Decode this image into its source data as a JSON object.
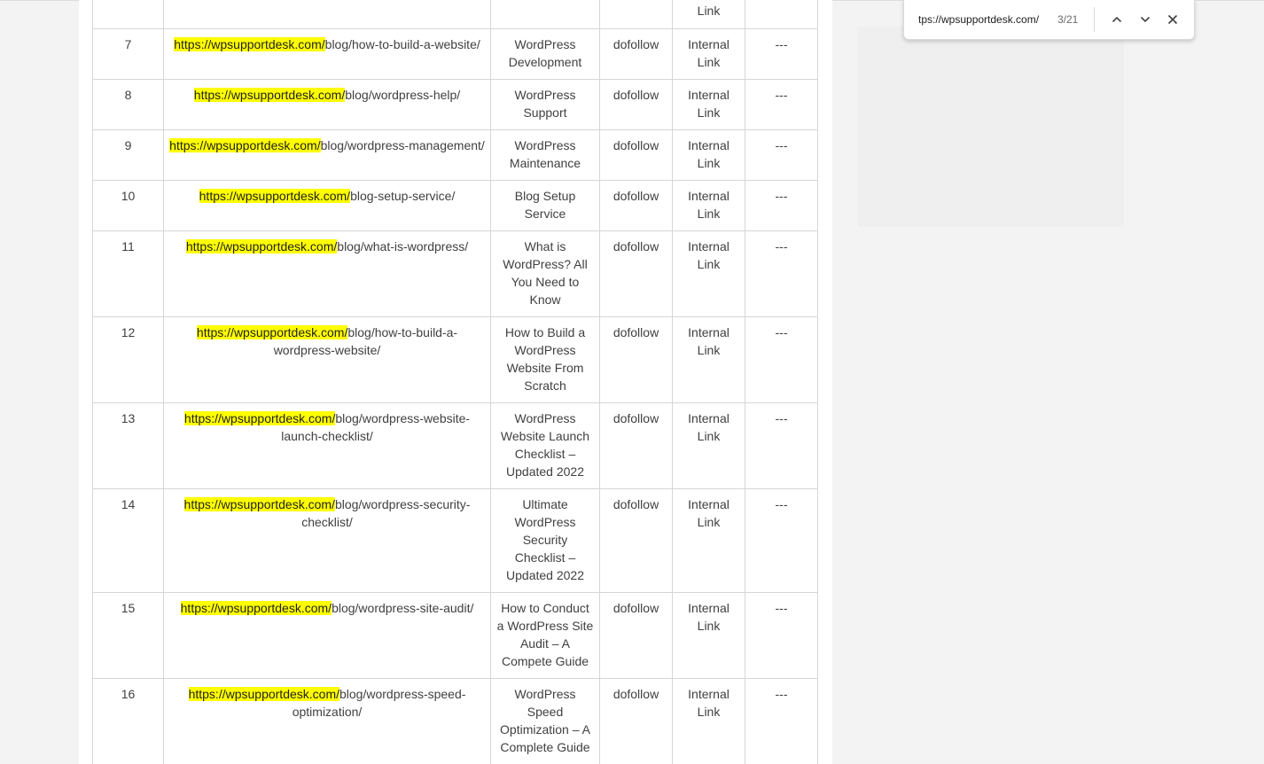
{
  "table": {
    "partial_row": {
      "num": "",
      "url_prefix": "",
      "url_rest": "",
      "anchor": "",
      "rel": "",
      "type": "Link",
      "extra": ""
    },
    "rows": [
      {
        "num": "7",
        "url_prefix": "https://wpsupportdesk.com/",
        "url_rest": "blog/how-to-build-a-website/",
        "anchor": "WordPress Development",
        "rel": "dofollow",
        "type": "Internal Link",
        "extra": "---"
      },
      {
        "num": "8",
        "url_prefix": "https://wpsupportdesk.com/",
        "url_rest": "blog/wordpress-help/",
        "anchor": "WordPress Support",
        "rel": "dofollow",
        "type": "Internal Link",
        "extra": "---"
      },
      {
        "num": "9",
        "url_prefix": "https://wpsupportdesk.com/",
        "url_rest": "blog/wordpress-management/",
        "anchor": "WordPress Maintenance",
        "rel": "dofollow",
        "type": "Internal Link",
        "extra": "---"
      },
      {
        "num": "10",
        "url_prefix": "https://wpsupportdesk.com/",
        "url_rest": "blog-setup-service/",
        "anchor": "Blog Setup Service",
        "rel": "dofollow",
        "type": "Internal Link",
        "extra": "---"
      },
      {
        "num": "11",
        "url_prefix": "https://wpsupportdesk.com/",
        "url_rest": "blog/what-is-wordpress/",
        "anchor": "What is WordPress? All You Need to Know",
        "rel": "dofollow",
        "type": "Internal Link",
        "extra": "---"
      },
      {
        "num": "12",
        "url_prefix": "https://wpsupportdesk.com/",
        "url_rest": "blog/how-to-build-a-wordpress-website/",
        "anchor": "How to Build a WordPress Website From Scratch",
        "rel": "dofollow",
        "type": "Internal Link",
        "extra": "---"
      },
      {
        "num": "13",
        "url_prefix": "https://wpsupportdesk.com/",
        "url_rest": "blog/wordpress-website-launch-checklist/",
        "anchor": "WordPress Website Launch Checklist – Updated 2022",
        "rel": "dofollow",
        "type": "Internal Link",
        "extra": "---"
      },
      {
        "num": "14",
        "url_prefix": "https://wpsupportdesk.com/",
        "url_rest": "blog/wordpress-security-checklist/",
        "anchor": "Ultimate WordPress Security Checklist – Updated 2022",
        "rel": "dofollow",
        "type": "Internal Link",
        "extra": "---"
      },
      {
        "num": "15",
        "url_prefix": "https://wpsupportdesk.com/",
        "url_rest": "blog/wordpress-site-audit/",
        "anchor": "How to Conduct a WordPress Site Audit – A Compete Guide",
        "rel": "dofollow",
        "type": "Internal Link",
        "extra": "---"
      },
      {
        "num": "16",
        "url_prefix": "https://wpsupportdesk.com/",
        "url_rest": "blog/wordpress-speed-optimization/",
        "anchor": "WordPress Speed Optimization – A Complete Guide",
        "rel": "dofollow",
        "type": "Internal Link",
        "extra": "---"
      }
    ]
  },
  "find_bar": {
    "query": "tps://wpsupportdesk.com/",
    "match_count": "3/21",
    "prev_icon": "chevron-up-icon",
    "next_icon": "chevron-down-icon",
    "close_icon": "close-icon"
  },
  "colors": {
    "highlight": "#ffff00",
    "page_bg": "#f3f3f3",
    "content_bg": "#ffffff",
    "border": "#d6d6d6"
  }
}
